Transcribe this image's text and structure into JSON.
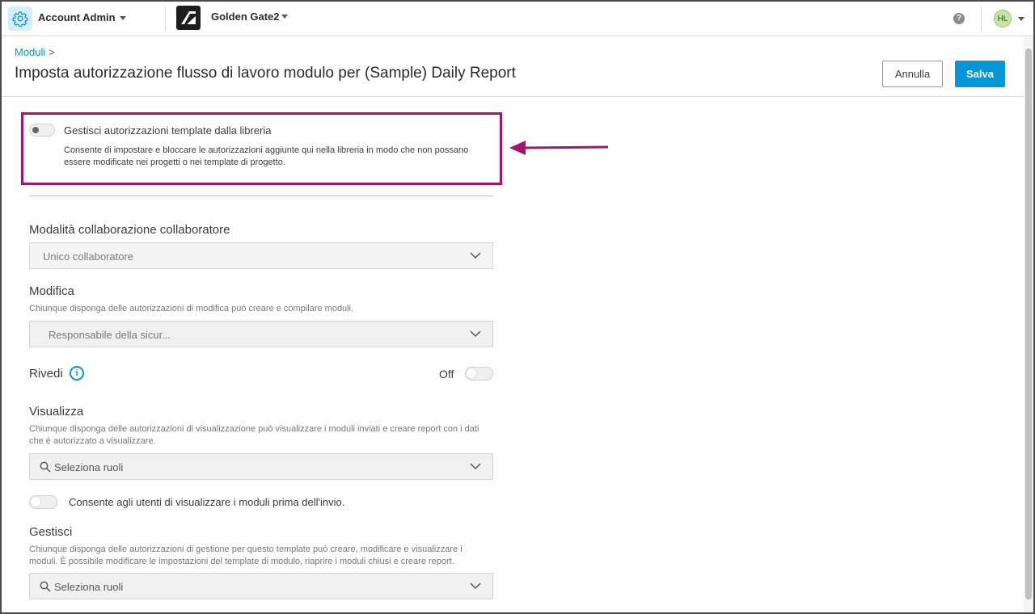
{
  "topbar": {
    "app_name": "Account Admin",
    "project_name": "Golden Gate2",
    "help_symbol": "?",
    "avatar_initials": "HL"
  },
  "header": {
    "breadcrumb": "Moduli",
    "breadcrumb_sep": ">",
    "title": "Imposta autorizzazione flusso di lavoro modulo per (Sample) Daily Report",
    "cancel_label": "Annulla",
    "save_label": "Salva"
  },
  "library": {
    "label": "Gestisci autorizzazioni template dalla libreria",
    "description": "Consente di impostare e bloccare le autorizzazioni aggiunte qui nella libreria in modo che non possano essere modificate nei progetti o nei template di progetto.",
    "enabled": false
  },
  "collaboration": {
    "label": "Modalità collaborazione collaboratore",
    "value": "Unico collaboratore"
  },
  "edit": {
    "label": "Modifica",
    "description": "Chiunque disponga delle autorizzazioni di modifica può creare e compilare moduli.",
    "value": "Responsabile della sicur..."
  },
  "review": {
    "label": "Rivedi",
    "info_symbol": "i",
    "state_label": "Off",
    "enabled": false
  },
  "view": {
    "label": "Visualizza",
    "description": "Chiunque disponga delle autorizzazioni di visualizzazione può visualizzare i moduli inviati e creare report con i dati che è autorizzato a visualizzare.",
    "placeholder": "Seleziona ruoli",
    "preview_label": "Consente agli utenti di visualizzare i moduli prima dell'invio.",
    "preview_enabled": false
  },
  "manage": {
    "label": "Gestisci",
    "description": "Chiunque disponga delle autorizzazioni di gestione per questo template può creare, modificare e visualizzare i moduli. È possibile modificare le impostazioni del template di modulo, riaprire i moduli chiusi e creare report.",
    "placeholder": "Seleziona ruoli"
  },
  "colors": {
    "accent": "#0696d7",
    "highlight": "#a3146e"
  },
  "icons": [
    "gear-icon",
    "caret-down-icon",
    "project-logo-icon",
    "help-icon",
    "chevron-down-icon",
    "search-icon",
    "info-icon",
    "arrow-left-icon"
  ]
}
